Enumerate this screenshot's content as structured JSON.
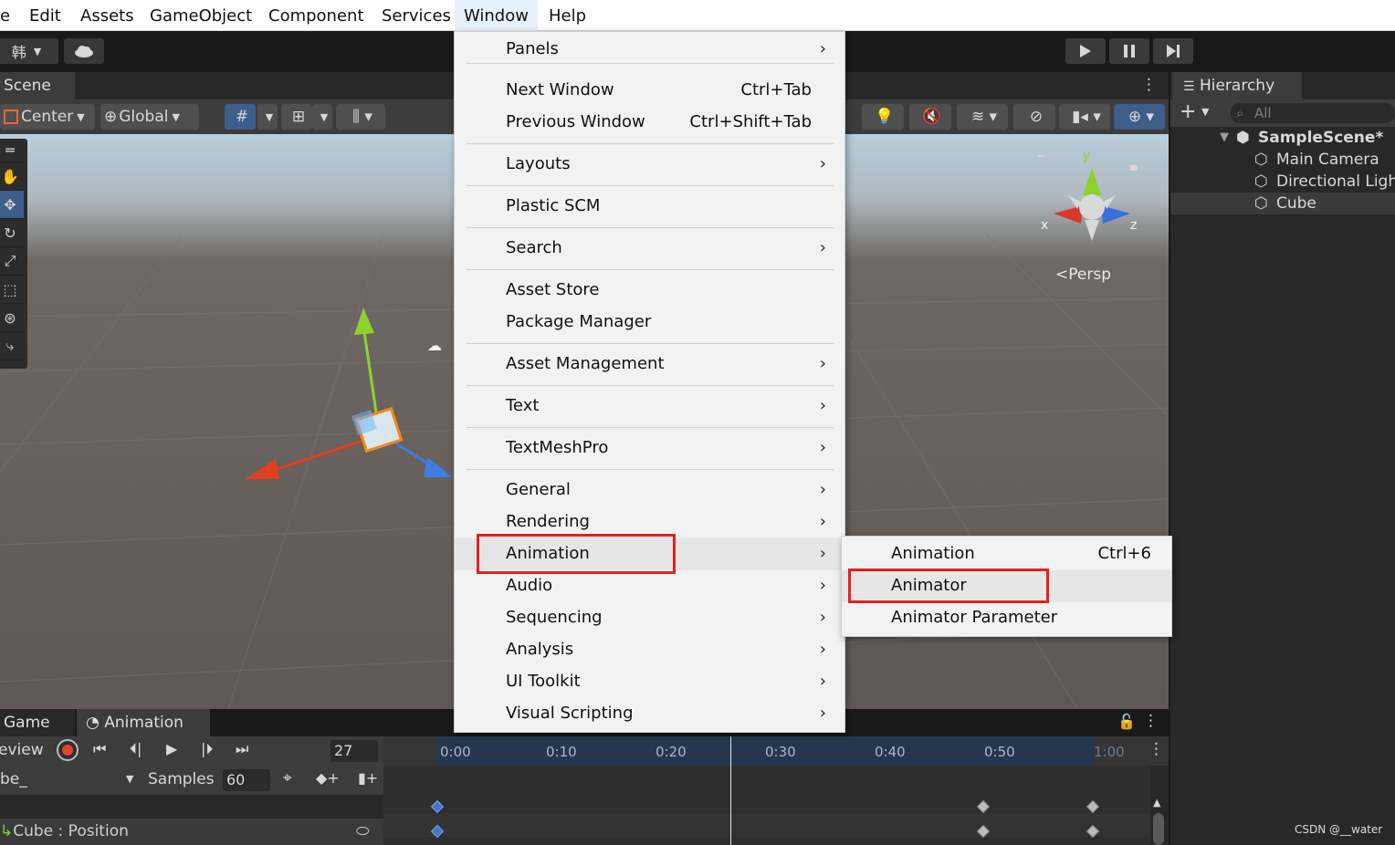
{
  "menubar": {
    "items": [
      "e",
      "Edit",
      "Assets",
      "GameObject",
      "Component",
      "Services",
      "Window",
      "Help"
    ]
  },
  "toolbar": {
    "account_label": "韩",
    "play_icon": "play-icon",
    "pause_icon": "pause-icon",
    "step_icon": "step-icon"
  },
  "scene": {
    "tab_label": "Scene",
    "pivot_label": "Center",
    "space_label": "Global",
    "persp_label": "Persp",
    "gizmo_axes": [
      "y",
      "x",
      "z"
    ]
  },
  "hierarchy": {
    "tab_label": "Hierarchy",
    "search_placeholder": "All",
    "scene_name": "SampleScene*",
    "items": [
      "Main Camera",
      "Directional Ligh",
      "Cube"
    ]
  },
  "window_menu": {
    "items": [
      {
        "label": "Panels",
        "shortcut": "",
        "submenu": true
      },
      {
        "label": "Next Window",
        "shortcut": "Ctrl+Tab",
        "submenu": false
      },
      {
        "label": "Previous Window",
        "shortcut": "Ctrl+Shift+Tab",
        "submenu": false
      },
      {
        "label": "Layouts",
        "shortcut": "",
        "submenu": true
      },
      {
        "label": "Plastic SCM",
        "shortcut": "",
        "submenu": false
      },
      {
        "label": "Search",
        "shortcut": "",
        "submenu": true
      },
      {
        "label": "Asset Store",
        "shortcut": "",
        "submenu": false
      },
      {
        "label": "Package Manager",
        "shortcut": "",
        "submenu": false
      },
      {
        "label": "Asset Management",
        "shortcut": "",
        "submenu": true
      },
      {
        "label": "Text",
        "shortcut": "",
        "submenu": true
      },
      {
        "label": "TextMeshPro",
        "shortcut": "",
        "submenu": true
      },
      {
        "label": "General",
        "shortcut": "",
        "submenu": true
      },
      {
        "label": "Rendering",
        "shortcut": "",
        "submenu": true
      },
      {
        "label": "Animation",
        "shortcut": "",
        "submenu": true
      },
      {
        "label": "Audio",
        "shortcut": "",
        "submenu": true
      },
      {
        "label": "Sequencing",
        "shortcut": "",
        "submenu": true
      },
      {
        "label": "Analysis",
        "shortcut": "",
        "submenu": true
      },
      {
        "label": "UI Toolkit",
        "shortcut": "",
        "submenu": true
      },
      {
        "label": "Visual Scripting",
        "shortcut": "",
        "submenu": true
      }
    ],
    "highlighted": "Animation"
  },
  "animation_submenu": {
    "items": [
      {
        "label": "Animation",
        "shortcut": "Ctrl+6"
      },
      {
        "label": "Animator",
        "shortcut": ""
      },
      {
        "label": "Animator Parameter",
        "shortcut": ""
      }
    ],
    "highlighted": "Animator"
  },
  "animation_window": {
    "tabs": [
      "Game",
      "Animation"
    ],
    "preview_label": "eview",
    "frame_value": "27",
    "clip_name": "be_",
    "samples_label": "Samples",
    "samples_value": "60",
    "timeline_ticks": [
      "0:00",
      "0:10",
      "0:20",
      "0:30",
      "0:40",
      "0:50",
      "1:00"
    ],
    "property_label": "Cube : Position"
  },
  "watermark": "CSDN @__water",
  "colors": {
    "highlight_box": "#e62020",
    "selection_blue": "#3d5d8a"
  }
}
